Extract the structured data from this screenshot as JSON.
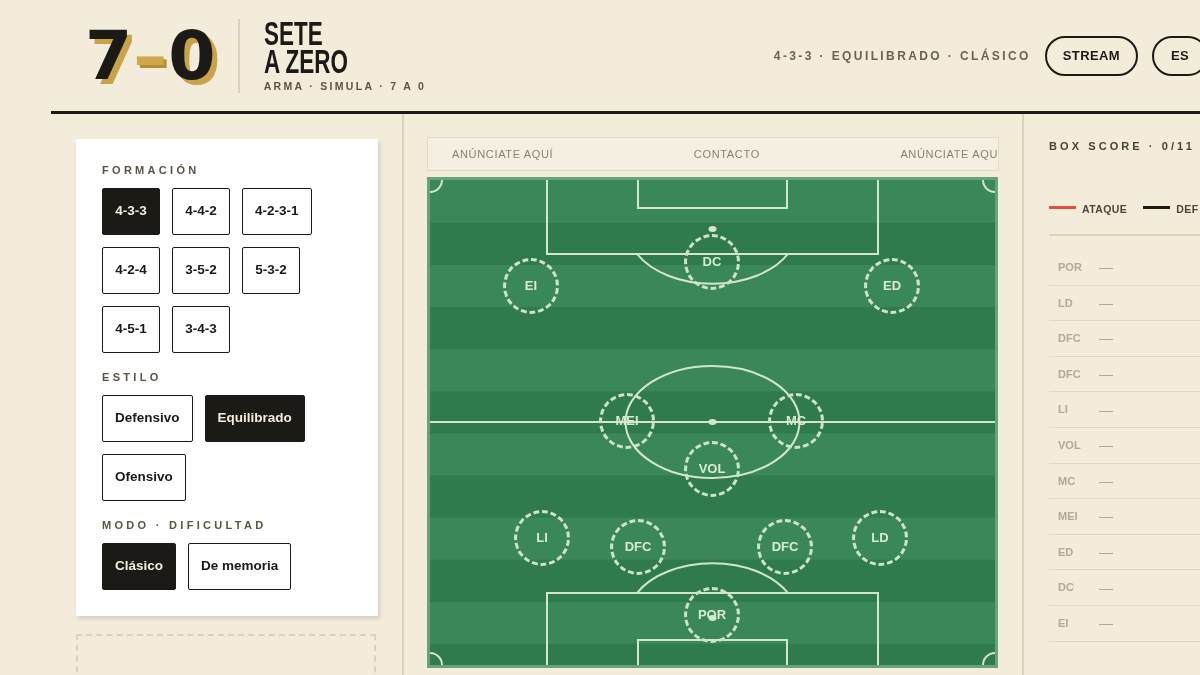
{
  "header": {
    "logo": [
      {
        "text": "7",
        "kind": "digit"
      },
      {
        "text": "–",
        "kind": "dash"
      },
      {
        "text": "0",
        "kind": "digit"
      }
    ],
    "title_lines": [
      "SETE",
      "A ZERO"
    ],
    "tagline": "ARMA · SIMULA · 7 A 0",
    "summary": "4-3-3 · EQUILIBRADO · CLÁSICO",
    "buttons": [
      {
        "label": "STREAM"
      },
      {
        "label": "ES"
      }
    ]
  },
  "setup_panel": {
    "sections": [
      {
        "label": "FORMACIÓN",
        "options": [
          {
            "label": "4-3-3",
            "selected": true
          },
          {
            "label": "4-4-2",
            "selected": false
          },
          {
            "label": "4-2-3-1",
            "selected": false
          },
          {
            "label": "4-2-4",
            "selected": false
          },
          {
            "label": "3-5-2",
            "selected": false
          },
          {
            "label": "5-3-2",
            "selected": false
          },
          {
            "label": "4-5-1",
            "selected": false
          },
          {
            "label": "3-4-3",
            "selected": false
          }
        ]
      },
      {
        "label": "ESTILO",
        "options": [
          {
            "label": "Defensivo",
            "selected": false
          },
          {
            "label": "Equilibrado",
            "selected": true
          },
          {
            "label": "Ofensivo",
            "selected": false
          }
        ]
      },
      {
        "label": "MODO · DIFICULTAD",
        "options": [
          {
            "label": "Clásico",
            "selected": true
          },
          {
            "label": "De memoria",
            "selected": false
          }
        ]
      }
    ]
  },
  "ad_strip": {
    "items": [
      "ANÚNCIATE AQUÍ",
      "CONTACTO",
      "ANÚNCIATE AQU"
    ]
  },
  "pitch": {
    "players": [
      {
        "position": "DC"
      },
      {
        "position": "EI"
      },
      {
        "position": "ED"
      },
      {
        "position": "MEI"
      },
      {
        "position": "MC"
      },
      {
        "position": "VOL"
      },
      {
        "position": "LI"
      },
      {
        "position": "DFC"
      },
      {
        "position": "DFC"
      },
      {
        "position": "LD"
      },
      {
        "position": "POR"
      }
    ]
  },
  "box_score": {
    "title": "BOX SCORE · 0/11",
    "legend": [
      {
        "label": "ATAQUE",
        "color": "#e0533a"
      },
      {
        "label": "DEF",
        "color": "#1c1a17"
      }
    ],
    "rows": [
      {
        "position": "POR",
        "player": "—"
      },
      {
        "position": "LD",
        "player": "—"
      },
      {
        "position": "DFC",
        "player": "—"
      },
      {
        "position": "DFC",
        "player": "—"
      },
      {
        "position": "LI",
        "player": "—"
      },
      {
        "position": "VOL",
        "player": "—"
      },
      {
        "position": "MC",
        "player": "—"
      },
      {
        "position": "MEI",
        "player": "—"
      },
      {
        "position": "ED",
        "player": "—"
      },
      {
        "position": "DC",
        "player": "—"
      },
      {
        "position": "EI",
        "player": "—"
      }
    ]
  }
}
